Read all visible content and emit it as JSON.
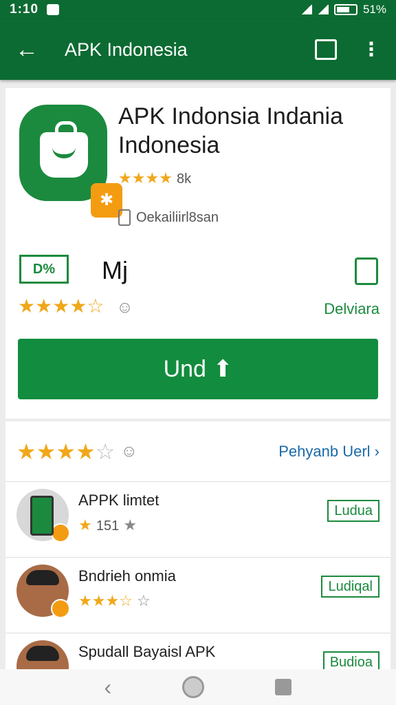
{
  "status": {
    "time": "1:10",
    "battery": "51%"
  },
  "appbar": {
    "title": "APK Indonesia",
    "back_icon": "back-arrow-icon",
    "search_icon": "search-icon",
    "menu_icon": "more-vert-icon"
  },
  "app": {
    "title": "APK Indonsia Indania Indonesia",
    "stars": "★★★★",
    "rating_count": "8k",
    "info": "Oekailiirl8san",
    "rating_box": "D%",
    "mj": "Mj",
    "stars2": "★★★★☆",
    "delivery": "Delviara",
    "install_label": "Und"
  },
  "ratings": {
    "stars_full": "★★★★",
    "stars_empty": "☆",
    "link": "Pehyanb Uerl"
  },
  "list": [
    {
      "name": "APPK limtet",
      "stars": "★",
      "count": "151",
      "extra": "★",
      "button": "Ludua"
    },
    {
      "name": "Bndrieh onmia",
      "stars": "★★★☆",
      "count": "",
      "extra": "☆",
      "button": "Ludiqal"
    },
    {
      "name": "Spudall Bayaisl APK",
      "stars": "★★★",
      "count": "",
      "extra": "",
      "button": "Budioa"
    }
  ],
  "colors": {
    "primary": "#0c6b32",
    "accent": "#128c3e",
    "star": "#f0a81a",
    "link": "#1a6aa8"
  }
}
